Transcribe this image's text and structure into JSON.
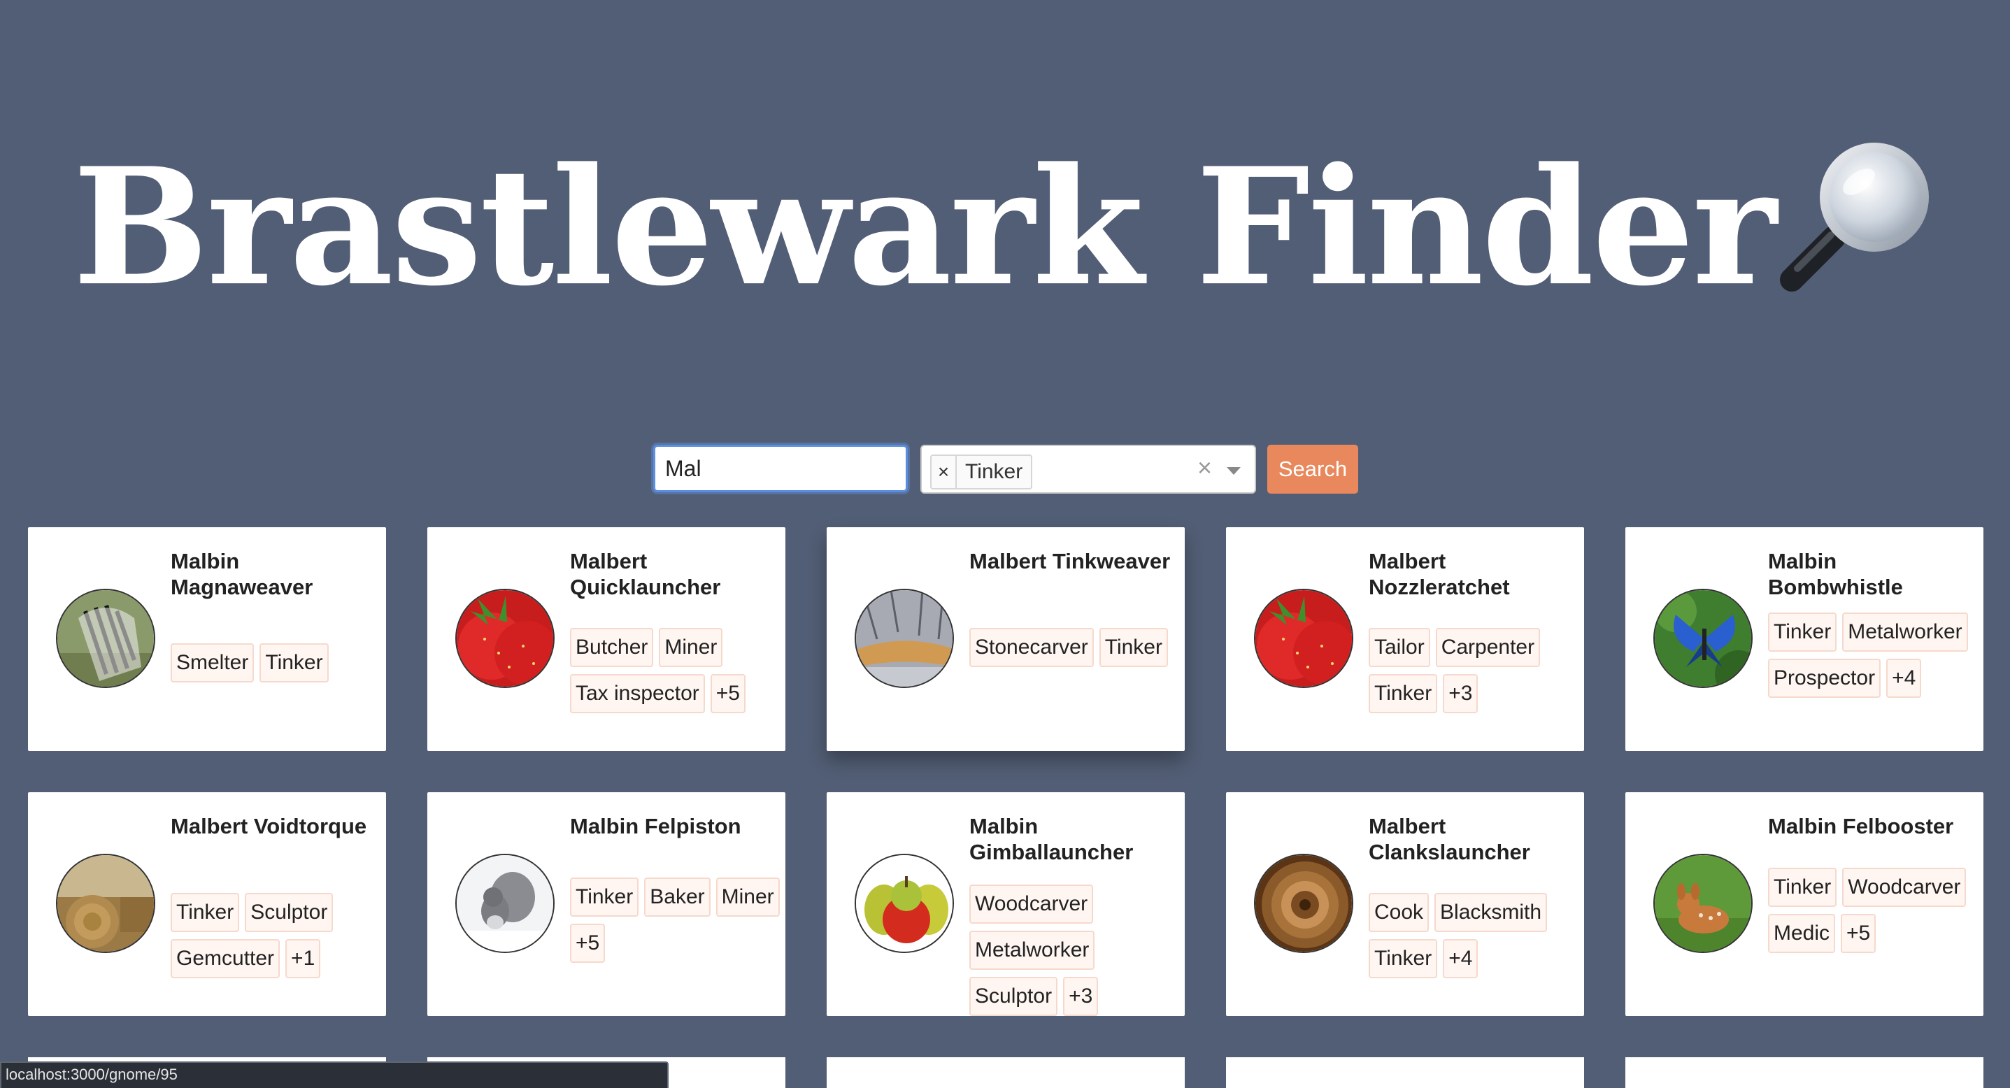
{
  "page_title": "Brastlewark Finder",
  "search": {
    "name_value": "Mal",
    "selected_profession": "Tinker",
    "remove_symbol": "×",
    "clear_symbol": "×",
    "button_label": "Search"
  },
  "cards": [
    {
      "name": "Malbin Magnaweaver",
      "image": "zebra",
      "professions": [
        "Smelter",
        "Tinker"
      ]
    },
    {
      "name": "Malbert Quicklauncher",
      "image": "strawberries",
      "professions": [
        "Butcher",
        "Miner",
        "Tax inspector",
        "+5"
      ]
    },
    {
      "name": "Malbert Tinkweaver",
      "image": "winter-stream",
      "professions": [
        "Stonecarver",
        "Tinker"
      ]
    },
    {
      "name": "Malbert Nozzleratchet",
      "image": "strawberries",
      "professions": [
        "Tailor",
        "Carpenter",
        "Tinker",
        "+3"
      ]
    },
    {
      "name": "Malbin Bombwhistle",
      "image": "butterfly",
      "professions": [
        "Tinker",
        "Metalworker",
        "Prospector",
        "+4"
      ]
    },
    {
      "name": "Malbert Voidtorque",
      "image": "hay-bales",
      "professions": [
        "Tinker",
        "Sculptor",
        "Gemcutter",
        "+1"
      ]
    },
    {
      "name": "Malbin Felpiston",
      "image": "squirrel",
      "professions": [
        "Tinker",
        "Baker",
        "Miner",
        "+5"
      ]
    },
    {
      "name": "Malbin Gimballauncher",
      "image": "apples-pears",
      "professions": [
        "Woodcarver",
        "Metalworker",
        "Sculptor",
        "+3"
      ]
    },
    {
      "name": "Malbert Clankslauncher",
      "image": "wooden-bowl",
      "professions": [
        "Cook",
        "Blacksmith",
        "Tinker",
        "+4"
      ]
    },
    {
      "name": "Malbin Felbooster",
      "image": "fawn",
      "professions": [
        "Tinker",
        "Woodcarver",
        "Medic",
        "+5"
      ]
    }
  ],
  "status_url": "localhost:3000/gnome/95"
}
